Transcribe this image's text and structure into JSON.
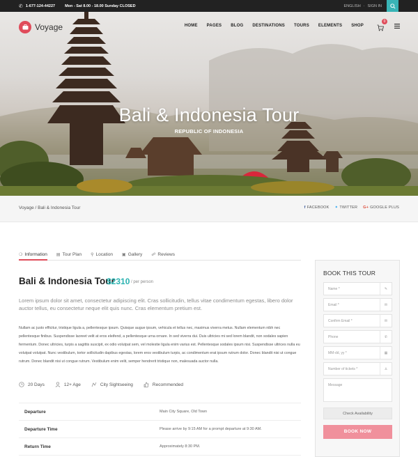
{
  "topbar": {
    "phone": "1-677-124-44227",
    "hours": "Mon - Sat 8.00 - 18.00 Sunday CLOSED",
    "language": "ENGLISH",
    "signin": "SIGN IN"
  },
  "brand": {
    "name": "Voyage"
  },
  "nav": {
    "items": [
      "HOME",
      "PAGES",
      "BLOG",
      "DESTINATIONS",
      "TOURS",
      "ELEMENTS",
      "SHOP"
    ]
  },
  "cart": {
    "count": "0"
  },
  "hero": {
    "title": "Bali & Indonesia Tour",
    "subtitle": "REPUBLIC OF INDONESIA"
  },
  "breadcrumb": {
    "text": "Voyage / Bali & Indonesia Tour"
  },
  "share": {
    "facebook": "FACEBOOK",
    "twitter": "TWITTER",
    "google": "GOOGLE PLUS"
  },
  "tabs": [
    "Information",
    "Tour Plan",
    "Location",
    "Gallery",
    "Reviews"
  ],
  "tour": {
    "title": "Bali & Indonesia Tour",
    "price": "$2310",
    "per": "/ per person",
    "lead": "Lorem ipsum dolor sit amet, consectetur adipiscing elit. Cras sollicitudin, tellus vitae condimentum egestas, libero dolor auctor tellus, eu consectetur neque elit quis nunc. Cras elementum pretium est.",
    "body": "Nullam ac justo efficitur, tristique ligula a, pellentesque ipsum. Quisque augue ipsum, vehicula et tellus nec, maximus viverra metus. Nullam elementum nibh nec pellentesque finibus. Suspendisse laoreet velit at eros eleifend, a pellentesque urna ornare. In sed viverra dui. Duis ultricies mi sed lorem blandit, non sodales sapien fermentum. Donec ultricies, turpis a sagittis suscipit, ex odio volutpat sem, vel molestie ligula enim varius est. Pellentesque sodales ipsum nisi. Suspendisse ultrices nulla eu volutpat volutpat. Nunc vestibulum, tortor sollicitudin dapibus egestas, lorem eros vestibulum turpis, ac condimentum erat ipsum rutrum dolor. Donec blandit nisi ut congue rutrum. Donec blandit nisi ut congue rutrum. Vestibulum enim velit, semper hendrerit tristique non, malesuada auctor nulla.",
    "facts": [
      "20 Days",
      "12+ Age",
      "City Sightseeing",
      "Recommended"
    ],
    "details": [
      {
        "k": "Departure",
        "v": "Main City Square, Old Town"
      },
      {
        "k": "Departure Time",
        "v": "Please arrive by 9:15 AM for a prompt departure at 9:30 AM."
      },
      {
        "k": "Return Time",
        "v": "Approximately 8:30 PM."
      }
    ]
  },
  "booking": {
    "title": "BOOK THIS TOUR",
    "name": "Name *",
    "email": "Email *",
    "confirm": "Confirm Email *",
    "phone": "Phone",
    "date": "MM-dd, yy *",
    "tickets": "Number of tickets *",
    "message": "Message",
    "check": "Check Availability",
    "submit": "BOOK NOW"
  },
  "colors": {
    "accent": "#e04b5a",
    "teal": "#2bb3b1",
    "book": "#f0909c"
  }
}
